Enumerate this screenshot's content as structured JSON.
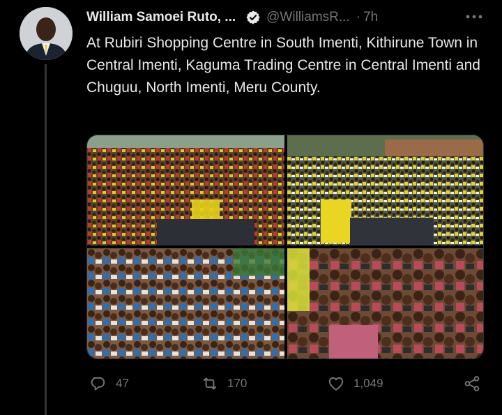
{
  "tweet": {
    "author_name": "William Samoei Ruto, ...",
    "handle": "@WilliamsR...",
    "separator": "·",
    "time": "7h",
    "text": "At Rubiri Shopping Centre in South Imenti, Kithirune Town in Central Imenti, Kaguma Trading Centre in Central Imenti and Chuguu, North Imenti, Meru County.",
    "media_count": 4
  },
  "actions": {
    "replies": "47",
    "retweets": "170",
    "likes": "1,049"
  },
  "icons": {
    "verified": "verified-badge-icon",
    "more": "more-dots-icon",
    "reply": "reply-bubble-icon",
    "retweet": "retweet-icon",
    "like": "heart-icon",
    "share": "share-icon"
  },
  "colors": {
    "background": "#000000",
    "text": "#e7e9ea",
    "muted": "#71767b",
    "thread_line": "#333639"
  }
}
